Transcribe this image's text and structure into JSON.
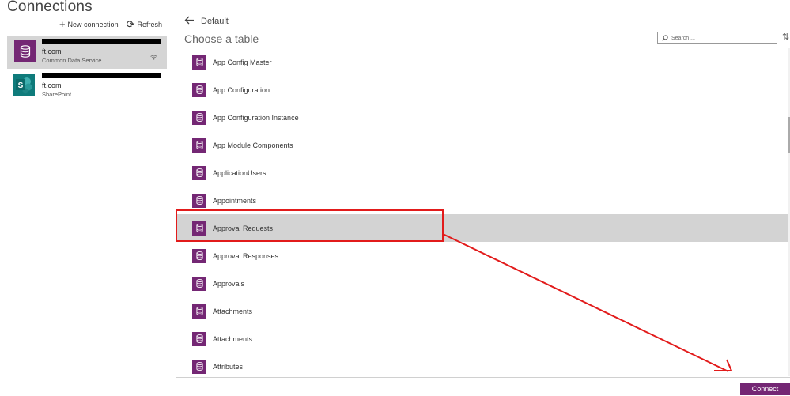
{
  "left": {
    "title": "Connections",
    "new_connection": "New connection",
    "refresh": "Refresh",
    "connections": [
      {
        "name": "ft.com",
        "type": "Common Data Service",
        "selected": true
      },
      {
        "name": "ft.com",
        "type": "SharePoint",
        "logo_letter": "S",
        "selected": false
      }
    ]
  },
  "header": {
    "back": "Default",
    "subtitle": "Choose a table"
  },
  "search": {
    "placeholder": "Search ..."
  },
  "tables": [
    "App Config Master",
    "App Configuration",
    "App Configuration Instance",
    "App Module Components",
    "ApplicationUsers",
    "Appointments",
    "Approval Requests",
    "Approval Responses",
    "Approvals",
    "Attachments",
    "Attachments",
    "Attributes"
  ],
  "selected_table": "Approval Requests",
  "footer": {
    "connect": "Connect"
  },
  "colors": {
    "accent": "#742774",
    "sharepoint": "#0f7b7b",
    "annotation": "#e21b1b",
    "selected": "#d3d3d3"
  },
  "icons": [
    "plus-icon",
    "refresh-icon",
    "database-icon",
    "sharepoint-icon",
    "wifi-icon",
    "back-arrow-icon",
    "search-icon",
    "sort-icon",
    "table-icon"
  ]
}
